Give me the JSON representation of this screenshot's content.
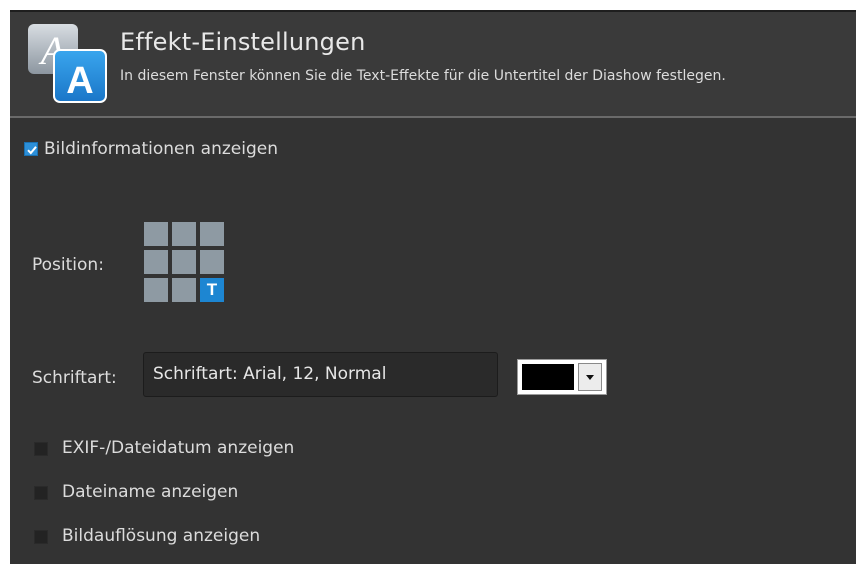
{
  "header": {
    "title": "Effekt-Einstellungen",
    "description": "In diesem Fenster können Sie die Text-Effekte für die Untertitel der Diashow festlegen.",
    "icon": "text-effects-icon"
  },
  "show_image_info": {
    "label": "Bildinformationen anzeigen",
    "checked": true
  },
  "position": {
    "label": "Position:",
    "selected_cell": "bottom-right",
    "marker_letter": "T",
    "colors": {
      "cell": "#8e9aa3",
      "active": "#1d86d2"
    }
  },
  "font": {
    "label": "Schriftart:",
    "button_text": "Schriftart: Arial, 12, Normal",
    "color": "#000000"
  },
  "options": [
    {
      "label": "EXIF-/Dateidatum anzeigen",
      "checked": false
    },
    {
      "label": "Dateiname anzeigen",
      "checked": false
    },
    {
      "label": "Bildauflösung anzeigen",
      "checked": false
    }
  ],
  "colors": {
    "background": "#333333",
    "header": "#3a3a3a",
    "accent": "#2c8fd8"
  }
}
